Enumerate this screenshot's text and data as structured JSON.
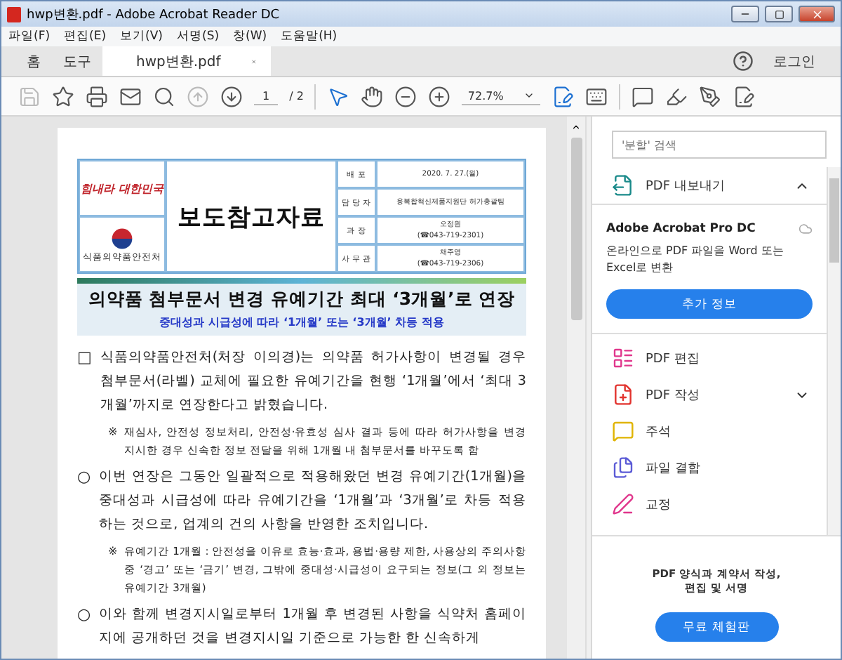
{
  "window": {
    "title": "hwp변환.pdf - Adobe Acrobat Reader DC"
  },
  "menu": [
    "파일(F)",
    "편집(E)",
    "보기(V)",
    "서명(S)",
    "창(W)",
    "도움말(H)"
  ],
  "tabs": [
    {
      "label": "홈",
      "selected": false
    },
    {
      "label": "도구",
      "selected": false
    },
    {
      "label": "hwp변환.pdf",
      "selected": true
    }
  ],
  "account": {
    "label": "로그인"
  },
  "toolbar": {
    "page_current": "1",
    "page_total": "/ 2",
    "zoom": "72.7%"
  },
  "document": {
    "slogan": "힘내라 대한민국",
    "agency": "식품의약품안전처",
    "title": "보도참고자료",
    "info": [
      {
        "label": "배 포",
        "value": "2020. 7. 27.(월)"
      },
      {
        "label": "담 당 자",
        "value": "융복합혁신제품지원단 허가총괄팀"
      },
      {
        "label": "과 장",
        "value": "오정원",
        "phone": "(☎043-719-2301)"
      },
      {
        "label": "사 무 관",
        "value": "채주영",
        "phone": "(☎043-719-2306)"
      }
    ],
    "headline": "의약품 첨부문서 변경 유예기간 최대 ‘3개월’로 연장",
    "subheadline": "중대성과 시급성에 따라 ‘1개월’ 또는 ‘3개월’ 차등 적용",
    "paragraphs": [
      {
        "kind": "main",
        "marker": "□",
        "text": "식품의약품안전처(처장 이의경)는 의약품 허가사항이 변경될 경우 첨부문서(라벨) 교체에 필요한 유예기간을 현행 ‘1개월’에서 ‘최대 3개월’까지로 연장한다고 밝혔습니다."
      },
      {
        "kind": "note",
        "marker": "※",
        "text": "재심사, 안전성 정보처리, 안전성·유효성 심사 결과 등에 따라 허가사항을 변경 지시한 경우 신속한 정보 전달을 위해 1개월 내 첨부문서를 바꾸도록 함"
      },
      {
        "kind": "main",
        "marker": "○",
        "text": "이번 연장은 그동안 일괄적으로 적용해왔던 변경 유예기간(1개월)을 중대성과 시급성에 따라 유예기간을 ‘1개월’과 ‘3개월’로 차등 적용하는 것으로, 업계의 건의 사항을 반영한 조치입니다."
      },
      {
        "kind": "note",
        "marker": "※",
        "text": "유예기간 1개월 : 안전성을 이유로 효능·효과, 용법·용량 제한, 사용상의 주의사항 중 ‘경고’ 또는 ‘금기’ 변경, 그밖에 중대성·시급성이 요구되는 정보(그 외 정보는 유예기간 3개월)"
      },
      {
        "kind": "main",
        "marker": "○",
        "text": "이와 함께 변경지시일로부터 1개월 후 변경된 사항을 식약처 홈페이지에 공개하던 것을 변경지시일 기준으로 가능한 한 신속하게"
      }
    ]
  },
  "panel": {
    "search": {
      "placeholder": "'분할' 검색"
    },
    "tools": [
      {
        "kind": "group",
        "label": "PDF 내보내기",
        "expanded": true
      },
      {
        "kind": "tool",
        "label": "PDF 편집"
      },
      {
        "kind": "group",
        "label": "PDF 작성",
        "expanded": false
      },
      {
        "kind": "tool",
        "label": "주석"
      },
      {
        "kind": "tool",
        "label": "파일 결합"
      },
      {
        "kind": "tool",
        "label": "교정"
      }
    ],
    "promo": {
      "title": "Adobe Acrobat Pro DC",
      "text": "온라인으로 PDF 파일을 Word 또는 Excel로 변환",
      "button": "추가 정보"
    },
    "footer": {
      "text": "PDF 양식과 계약서 작성,\n편집 및 서명",
      "button": "무료 체험판"
    }
  }
}
